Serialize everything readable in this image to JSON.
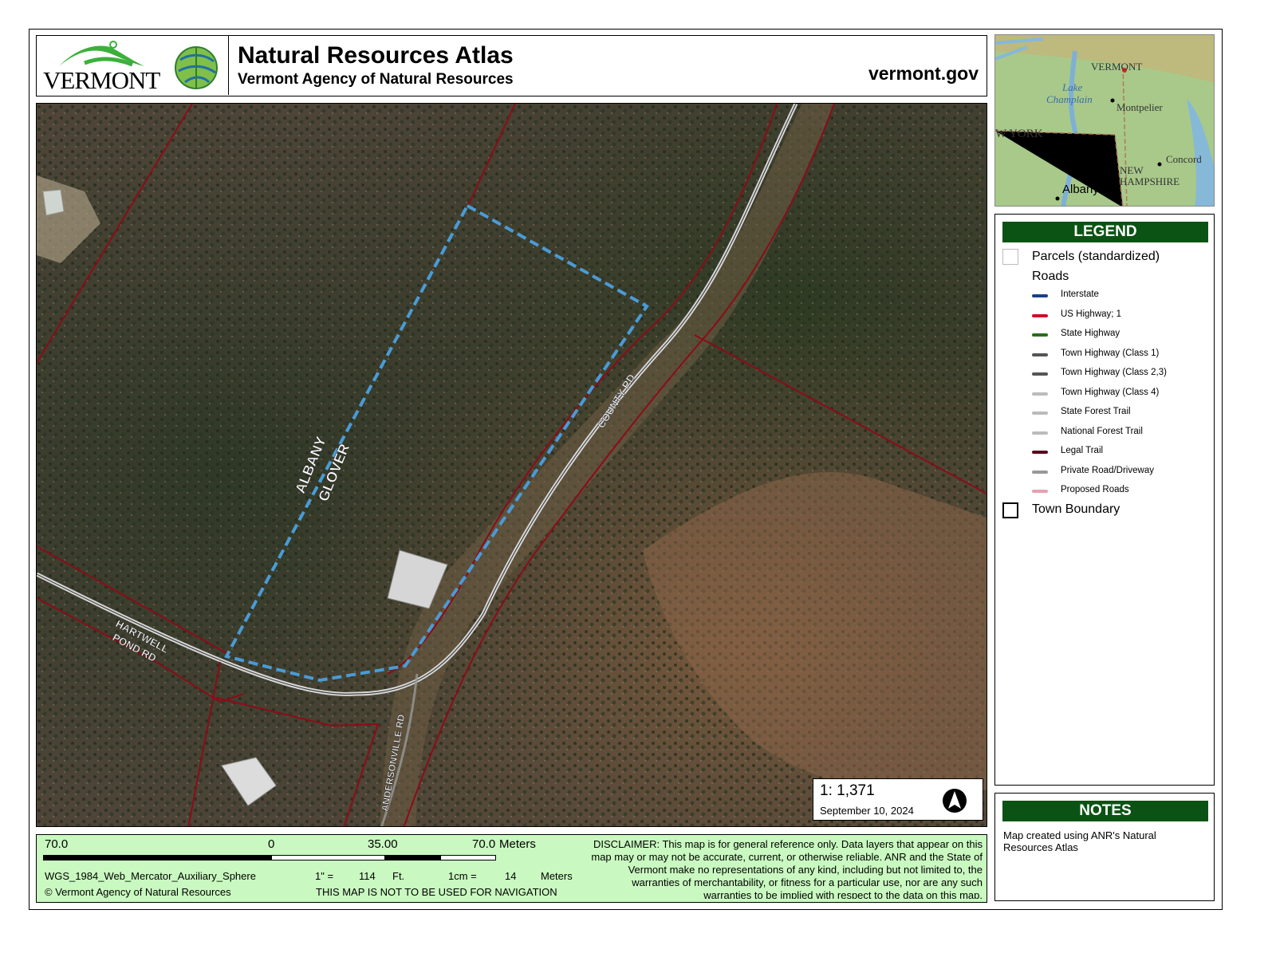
{
  "header": {
    "logo_text": "VERMONT",
    "title": "Natural Resources Atlas",
    "subtitle": "Vermont Agency of Natural Resources",
    "website": "vermont.gov"
  },
  "map": {
    "road_labels": [
      "ALBANY",
      "GLOVER",
      "COUNTY RD",
      "HARTWELL",
      "POND RD",
      "ANDERSONVILLE RD"
    ],
    "scale": "1:  1,371",
    "date": "September 10, 2024"
  },
  "inset": {
    "labels": [
      "VERMONT",
      "Lake",
      "Champlain",
      "Montpelier",
      "W YORK",
      "Concord",
      "NEW",
      "HAMPSHIRE",
      "Albany"
    ]
  },
  "legend": {
    "title": "LEGEND",
    "parcels": "Parcels (standardized)",
    "roads_header": "Roads",
    "roads": [
      {
        "label": "Interstate",
        "color": "#1a3f8a"
      },
      {
        "label": "US Highway; 1",
        "color": "#c8102e"
      },
      {
        "label": "State Highway",
        "color": "#2a6e1a"
      },
      {
        "label": "Town Highway (Class 1)",
        "color": "#555555"
      },
      {
        "label": "Town Highway (Class 2,3)",
        "color": "#555555"
      },
      {
        "label": "Town Highway (Class 4)",
        "color": "#bbbbbb"
      },
      {
        "label": "State Forest Trail",
        "color": "#bbbbbb"
      },
      {
        "label": "National Forest Trail",
        "color": "#bbbbbb"
      },
      {
        "label": "Legal Trail",
        "color": "#5a0a1a"
      },
      {
        "label": "Private Road/Driveway",
        "color": "#999999"
      },
      {
        "label": "Proposed Roads",
        "color": "#e8a0b0"
      }
    ],
    "town_boundary": "Town Boundary"
  },
  "notes": {
    "title": "NOTES",
    "text": "Map created using ANR's Natural Resources Atlas"
  },
  "footer": {
    "scale_ticks": [
      "70.0",
      "0",
      "35.00",
      "70.0"
    ],
    "scale_unit": "Meters",
    "projection": "WGS_1984_Web_Mercator_Auxiliary_Sphere",
    "inch_label": "1\" =",
    "inch_value": "114",
    "inch_unit": "Ft.",
    "cm_label": "1cm =",
    "cm_value": "14",
    "cm_unit": "Meters",
    "copyright": "© Vermont Agency of Natural Resources",
    "nav_warning": "THIS MAP IS NOT TO BE USED FOR NAVIGATION",
    "disclaimer": "DISCLAIMER: This map is for general reference only. Data layers that appear on this map may or may not be accurate, current, or otherwise reliable. ANR and the State of Vermont make no representations of any kind, including but not limited to, the warranties of merchantability, or fitness for a particular use, nor are any such warranties to be implied with respect to the data on this map."
  }
}
